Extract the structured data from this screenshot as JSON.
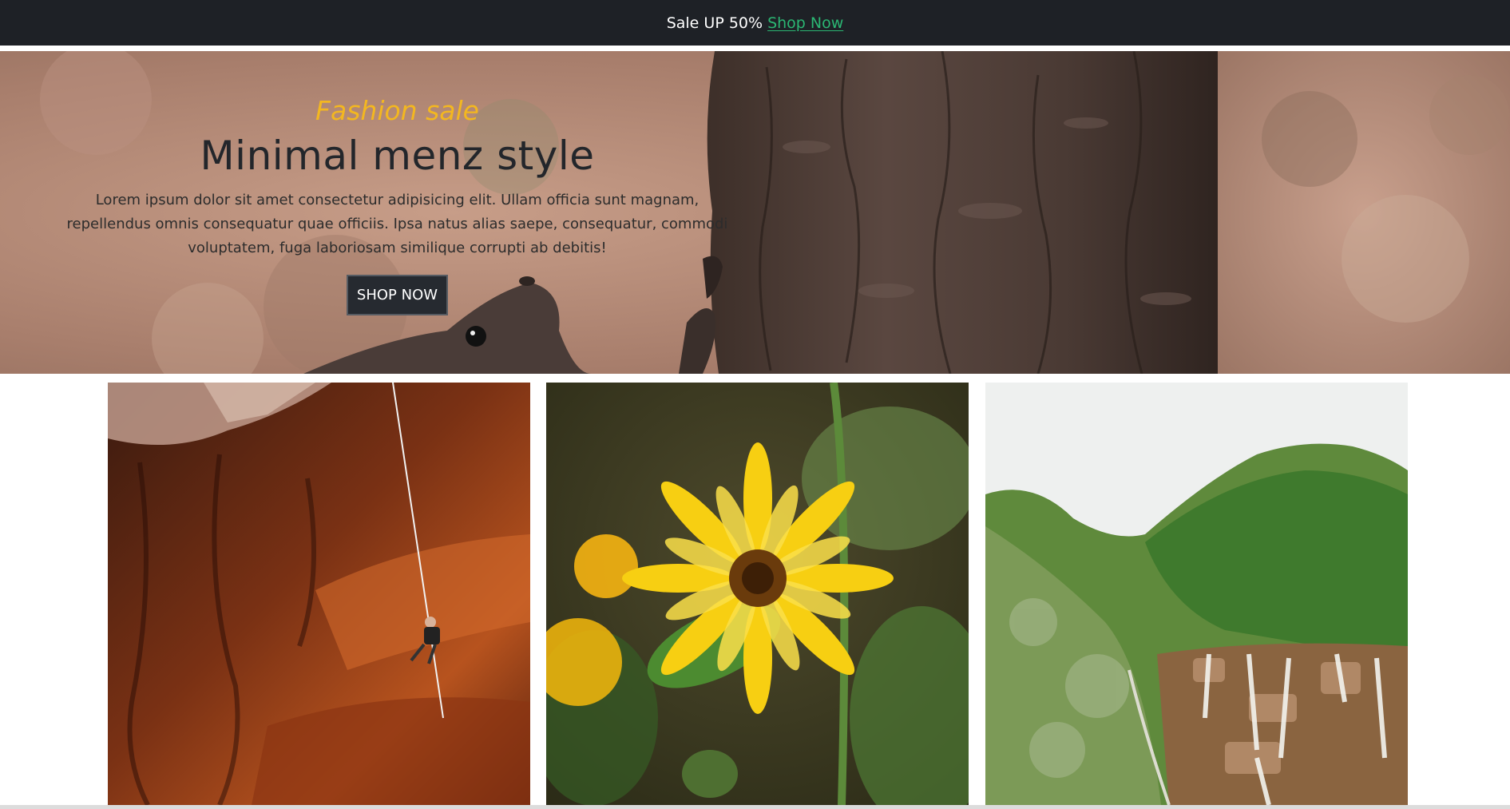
{
  "announcement": {
    "text": "Sale UP 50%",
    "link_label": "Shop Now"
  },
  "hero": {
    "kicker": "Fashion sale",
    "title": "Minimal menz style",
    "description": "Lorem ipsum dolor sit amet consectetur adipisicing elit. Ullam officia sunt magnam, repellendus omnis consequatur quae officiis. Ipsa natus alias saepe, consequatur, commodi voluptatem, fuga laboriosam similique corrupti ab debitis!",
    "button_label": "SHOP NOW"
  },
  "colors": {
    "topbar_bg": "#1e2126",
    "link_green": "#2bb673",
    "kicker_gold": "#f3b720",
    "button_dark": "#262a30"
  }
}
